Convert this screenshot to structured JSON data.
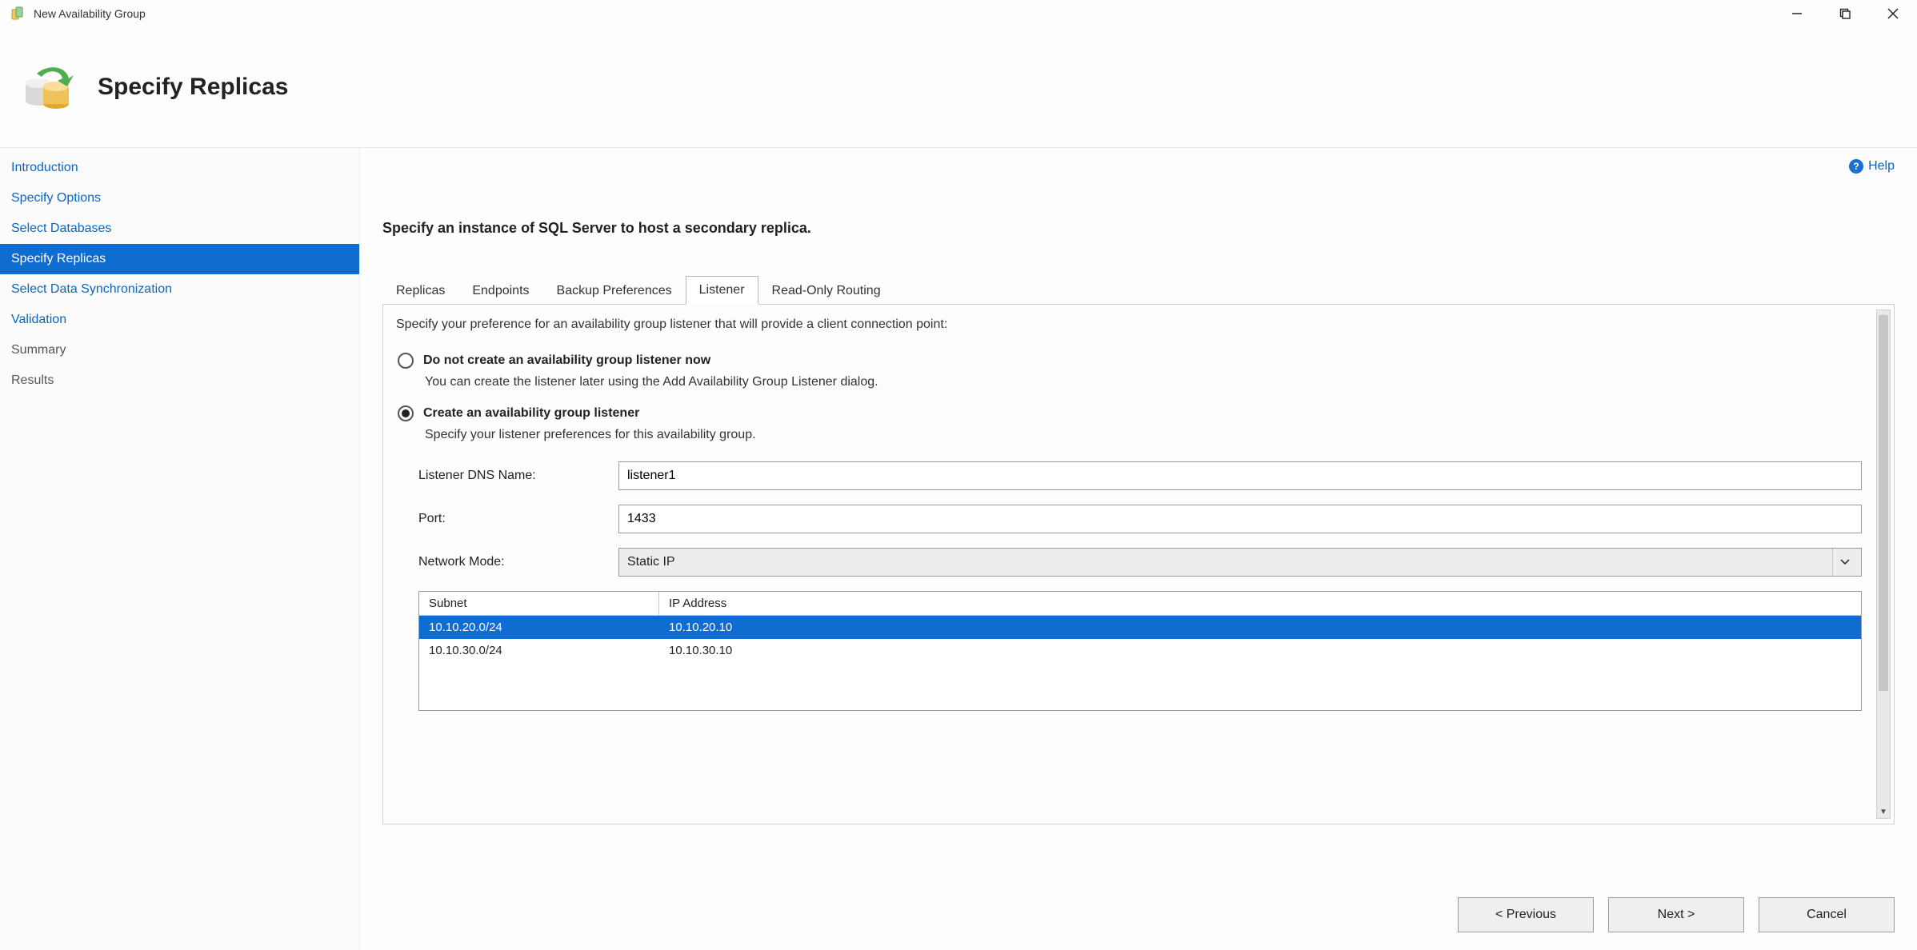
{
  "window": {
    "title": "New Availability Group"
  },
  "header": {
    "title": "Specify Replicas"
  },
  "sidebar": {
    "items": [
      {
        "label": "Introduction"
      },
      {
        "label": "Specify Options"
      },
      {
        "label": "Select Databases"
      },
      {
        "label": "Specify Replicas"
      },
      {
        "label": "Select Data Synchronization"
      },
      {
        "label": "Validation"
      },
      {
        "label": "Summary"
      },
      {
        "label": "Results"
      }
    ]
  },
  "help": {
    "label": "Help"
  },
  "instruction": "Specify an instance of SQL Server to host a secondary replica.",
  "tabs": {
    "items": [
      {
        "label": "Replicas"
      },
      {
        "label": "Endpoints"
      },
      {
        "label": "Backup Preferences"
      },
      {
        "label": "Listener"
      },
      {
        "label": "Read-Only Routing"
      }
    ],
    "active_index": 3
  },
  "listener": {
    "desc": "Specify your preference for an availability group listener that will provide a client connection point:",
    "option_none": {
      "label": "Do not create an availability group listener now",
      "sub": "You can create the listener later using the Add Availability Group Listener dialog."
    },
    "option_create": {
      "label": "Create an availability group listener",
      "sub": "Specify your listener preferences for this availability group."
    },
    "form": {
      "dns_label": "Listener DNS Name:",
      "dns_value": "listener1",
      "port_label": "Port:",
      "port_value": "1433",
      "mode_label": "Network Mode:",
      "mode_value": "Static IP"
    },
    "table": {
      "col_subnet": "Subnet",
      "col_ip": "IP Address",
      "rows": [
        {
          "subnet": "10.10.20.0/24",
          "ip": "10.10.20.10"
        },
        {
          "subnet": "10.10.30.0/24",
          "ip": "10.10.30.10"
        }
      ]
    }
  },
  "footer": {
    "previous": "< Previous",
    "next": "Next >",
    "cancel": "Cancel"
  }
}
